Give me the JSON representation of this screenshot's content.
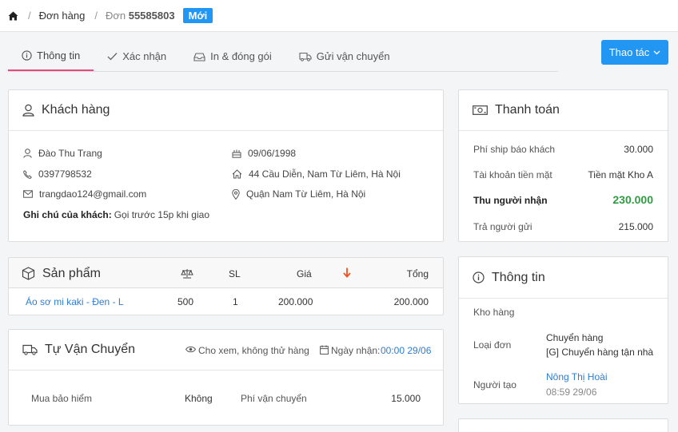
{
  "breadcrumb": {
    "orders": "Đơn hàng",
    "order_prefix": "Đơn",
    "order_number": "55585803",
    "status": "Mới"
  },
  "tabs": [
    {
      "label": "Thông tin",
      "icon": "info-icon"
    },
    {
      "label": "Xác nhận",
      "icon": "check-icon"
    },
    {
      "label": "In & đóng gói",
      "icon": "package-icon"
    },
    {
      "label": "Gửi vận chuyển",
      "icon": "truck-icon"
    }
  ],
  "action_button": "Thao tác",
  "customer": {
    "title": "Khách hàng",
    "name": "Đào Thu Trang",
    "phone": "0397798532",
    "email": "trangdao124@gmail.com",
    "note_label": "Ghi chú của khách:",
    "note": "Gọi trước 15p khi giao",
    "birthday": "09/06/1998",
    "address": "44 Cầu Diễn, Nam Từ Liêm, Hà Nội",
    "district": "Quận Nam Từ Liêm, Hà Nội"
  },
  "products": {
    "title": "Sản phẩm",
    "col_qty": "SL",
    "col_price": "Giá",
    "col_total": "Tổng",
    "items": [
      {
        "name": "Áo sơ mi kaki - Đen - L",
        "weight": "500",
        "qty": "1",
        "price": "200.000",
        "total": "200.000"
      }
    ]
  },
  "shipping": {
    "title": "Tự Vận Chuyển",
    "view_note": "Cho xem, không thử hàng",
    "receive_label": "Ngày nhận:",
    "receive_value": "00:00 29/06",
    "insurance_label": "Mua bảo hiểm",
    "insurance_value": "Không",
    "fee_label": "Phí vận chuyển",
    "fee_value": "15.000"
  },
  "payment": {
    "title": "Thanh toán",
    "rows": [
      {
        "label": "Phí ship báo khách",
        "value": "30.000"
      },
      {
        "label": "Tài khoản tiền mặt",
        "value": "Tiền mặt Kho A"
      },
      {
        "label": "Thu người nhận",
        "value": "230.000"
      },
      {
        "label": "Trả người gửi",
        "value": "215.000"
      }
    ]
  },
  "info": {
    "title": "Thông tin",
    "warehouse_label": "Kho hàng",
    "type_label": "Loại đơn",
    "type_value": "Chuyển hàng",
    "type_detail": "[G] Chuyển hàng tận nhà",
    "creator_label": "Người tạo",
    "creator_name": "Nông Thị Hoài",
    "creator_time": "08:59 29/06"
  },
  "colors": {
    "accent": "#2196f3",
    "tab_active": "#e8497a",
    "amount_green": "#2e9d3f",
    "sort_arrow": "#f4511e",
    "link": "#2e7dd1"
  }
}
